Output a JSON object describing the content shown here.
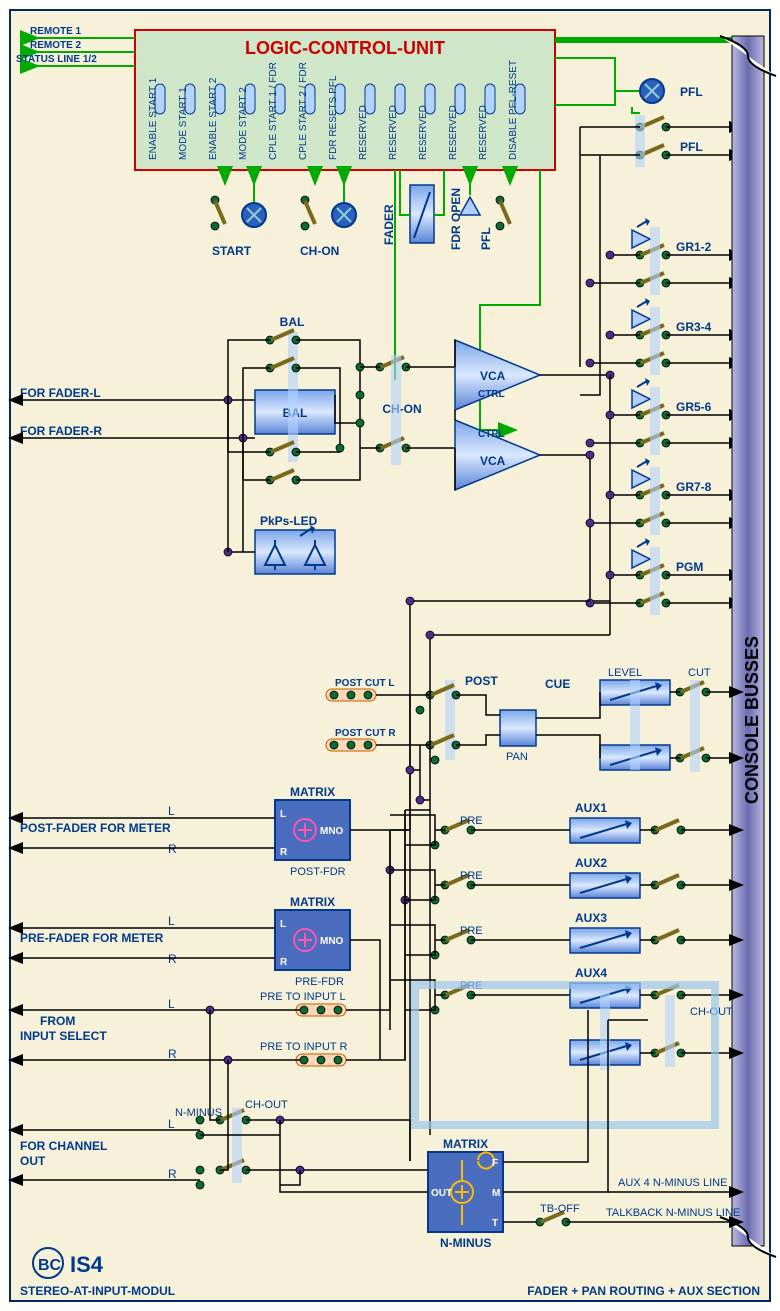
{
  "lcu": {
    "title": "LOGIC-CONTROL-UNIT",
    "lines": [
      "REMOTE 1",
      "REMOTE 2",
      "STATUS LINE 1/2"
    ],
    "pins": [
      "ENABLE START 1",
      "MODE START 1",
      "ENABLE START 2",
      "MODE START 2",
      "CPLE  START 1 / FDR",
      "CPLE  START 2 / FDR",
      "FDR RESETS PFL",
      "RESERVED",
      "RESERVED",
      "RESERVED",
      "RESERVED",
      "RESERVED",
      "DISABLE PFL-RESET"
    ],
    "below": [
      {
        "k": "start",
        "label": "START"
      },
      {
        "k": "chon",
        "label": "CH-ON"
      },
      {
        "k": "fader",
        "label": "FADER"
      },
      {
        "k": "fdro",
        "label": "FDR OPEN"
      },
      {
        "k": "pfl",
        "label": "PFL"
      }
    ],
    "pflbtn": "PFL",
    "pflrow": "PFL"
  },
  "labels": {
    "forfaderl": "FOR FADER-L",
    "forfaderr": "FOR FADER-R",
    "bal": "BAL",
    "bal2": "BAL",
    "pkps": "PkPs-LED",
    "vca": "VCA",
    "ctrl": "CTRL",
    "chon": "CH-ON",
    "gr12": "GR1-2",
    "gr34": "GR3-4",
    "gr56": "GR5-6",
    "gr78": "GR7-8",
    "pgm": "PGM",
    "console": "CONSOLE BUSSES",
    "postcutl": "POST CUT L",
    "postcutr": "POST CUT R",
    "post": "POST",
    "cue": "CUE",
    "level": "LEVEL",
    "cut": "CUT",
    "pan": "PAN",
    "matrix": "MATRIX",
    "postfdr": "POST-FDR",
    "prefdr": "PRE-FDR",
    "mno": "MNO",
    "L": "L",
    "R": "R",
    "postmeter": "POST-FADER FOR METER",
    "premeter": "PRE-FADER FOR METER",
    "pretoL": "PRE TO INPUT L",
    "pretoR": "PRE TO INPUT R",
    "frominput": "FROM",
    "frominput2": "INPUT SELECT",
    "pre": "PRE",
    "aux1": "AUX1",
    "aux2": "AUX2",
    "aux3": "AUX3",
    "aux4": "AUX4",
    "chout": "CH-OUT",
    "nminus": "N-MINUS",
    "nminusM": "N-MINUS",
    "forchan": "FOR CHANNEL",
    "out": "OUT",
    "chout2": "CH-OUT",
    "F": "F",
    "M": "M",
    "T": "T",
    "OUT": "OUT",
    "aux4nm": "AUX 4 N-MINUS LINE",
    "tbnm": "TALKBACK N-MINUS LINE",
    "tboff": "TB-OFF",
    "model": "IS4",
    "footer_l": "STEREO-AT-INPUT-MODUL",
    "footer_r": "FADER + PAN  ROUTING + AUX SECTION"
  }
}
